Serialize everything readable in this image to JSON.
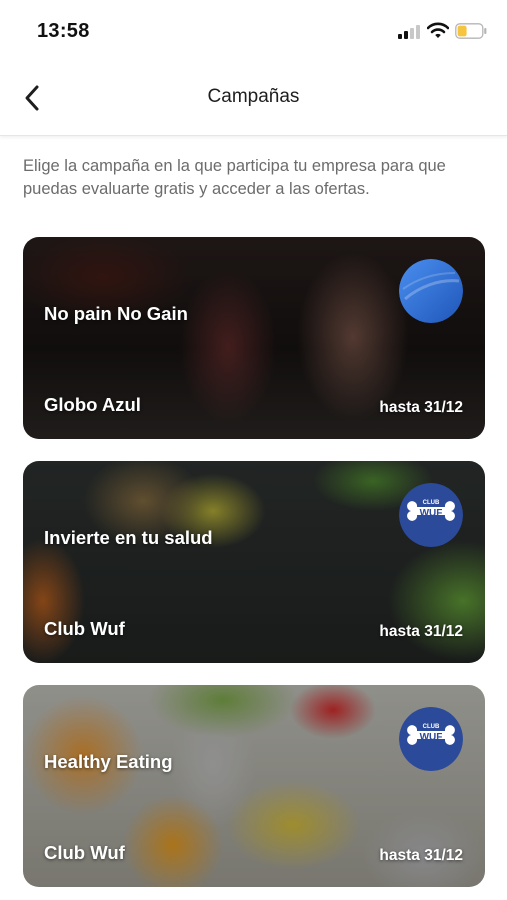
{
  "status_bar": {
    "time": "13:58",
    "icons": [
      "signal-icon",
      "wifi-icon",
      "battery-icon"
    ],
    "battery_color": "#f5c542"
  },
  "nav": {
    "title": "Campañas",
    "back_icon": "chevron-left-icon"
  },
  "intro_text": "Elige la campaña en la que participa tu empresa para que puedas evaluarte gratis y acceder a las ofertas.",
  "campaigns": [
    {
      "title": "No pain No Gain",
      "sponsor": "Globo Azul",
      "date": "hasta 31/12",
      "logo": "globo-azul-logo",
      "logo_color": "#2f6fd6"
    },
    {
      "title": "Invierte en tu salud",
      "sponsor": "Club Wuf",
      "date": "hasta 31/12",
      "logo": "club-wuf-logo",
      "logo_text_top": "CLUB",
      "logo_text": "WUF",
      "logo_color": "#2c4a9a"
    },
    {
      "title": "Healthy Eating",
      "sponsor": "Club Wuf",
      "date": "hasta 31/12",
      "logo": "club-wuf-logo",
      "logo_text_top": "CLUB",
      "logo_text": "WUF",
      "logo_color": "#2c4a9a"
    }
  ]
}
